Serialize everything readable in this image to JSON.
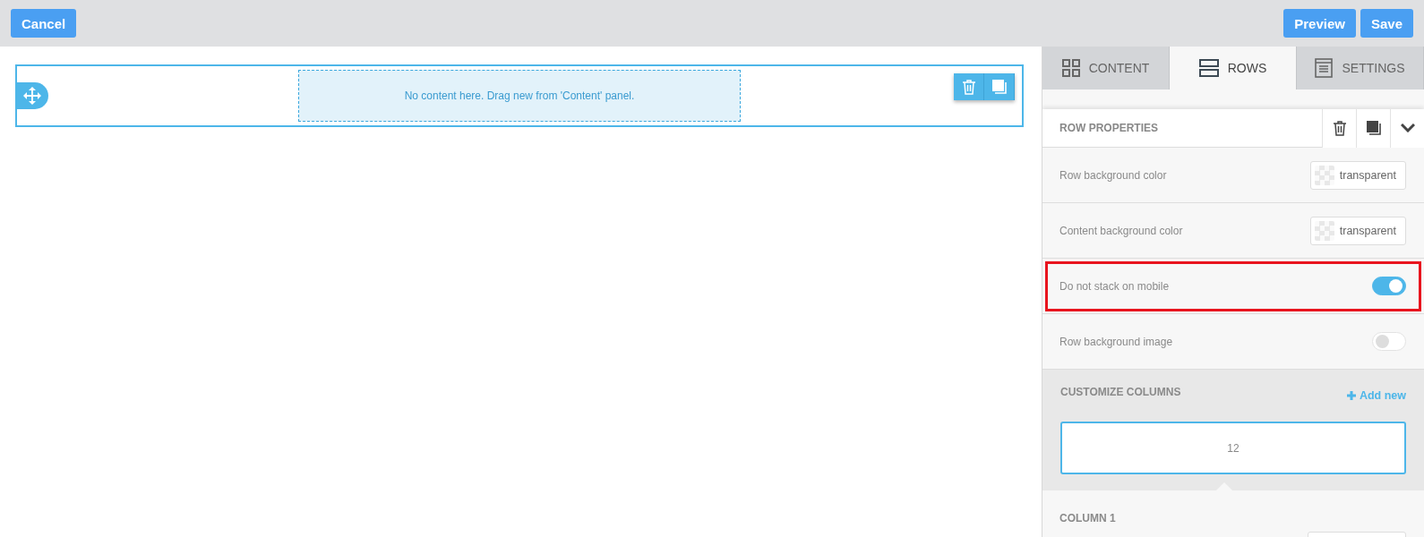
{
  "toolbar": {
    "left_buttons": [
      "Cancel"
    ],
    "right_buttons": [
      "Preview",
      "Save"
    ]
  },
  "canvas": {
    "row": {
      "selected": true,
      "placeholder_text": "No content here. Drag new from 'Content' panel."
    }
  },
  "tabs": [
    {
      "label": "CONTENT",
      "selected": false
    },
    {
      "label": "ROWS",
      "selected": true
    },
    {
      "label": "SETTINGS",
      "selected": false
    }
  ],
  "row_properties": {
    "title": "ROW PROPERTIES",
    "properties": [
      {
        "kind": "color",
        "label": "Row background color",
        "value": "transparent",
        "highlighted": false
      },
      {
        "kind": "color",
        "label": "Content background color",
        "value": "transparent",
        "highlighted": false
      },
      {
        "kind": "toggle",
        "label": "Do not stack on mobile",
        "on": true,
        "highlighted": true
      },
      {
        "kind": "toggle",
        "label": "Row background image",
        "on": false,
        "highlighted": false
      }
    ]
  },
  "customize_columns": {
    "title": "CUSTOMIZE COLUMNS",
    "add_link": "Add new",
    "columns": [
      {
        "label": "12",
        "selected": true
      }
    ]
  },
  "column_section": {
    "title": "COLUMN 1"
  }
}
